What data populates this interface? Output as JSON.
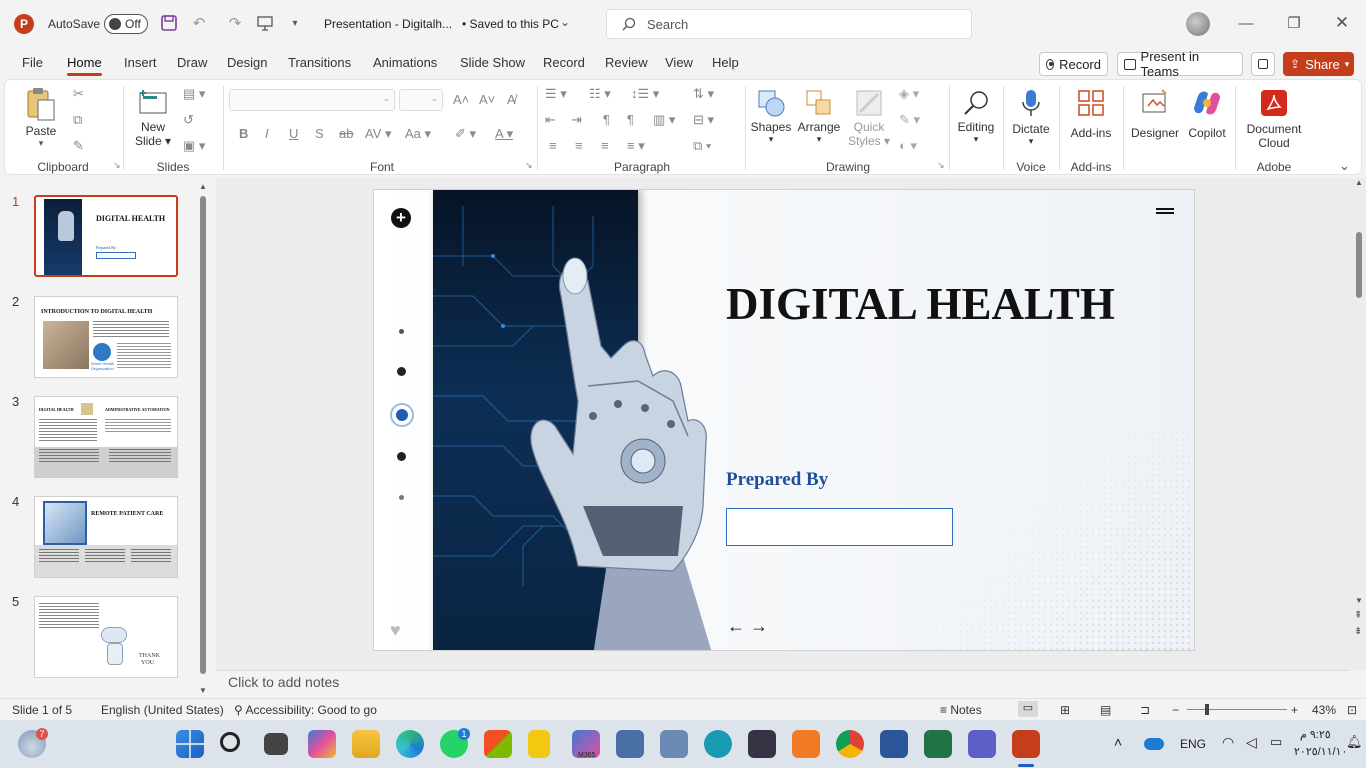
{
  "titlebar": {
    "autosave_label": "AutoSave",
    "autosave_state": "Off",
    "doc_title": "Presentation - Digitalh...",
    "save_status": "• Saved to this PC",
    "search_placeholder": "Search"
  },
  "menu": {
    "tabs": [
      "File",
      "Home",
      "Insert",
      "Draw",
      "Design",
      "Transitions",
      "Animations",
      "Slide Show",
      "Record",
      "Review",
      "View",
      "Help"
    ],
    "active_tab": "Home",
    "record_label": "Record",
    "present_teams_label": "Present in Teams",
    "share_label": "Share"
  },
  "ribbon": {
    "clipboard": {
      "paste": "Paste",
      "label": "Clipboard"
    },
    "slides": {
      "new_slide_line1": "New",
      "new_slide_line2": "Slide",
      "label": "Slides"
    },
    "font": {
      "label": "Font"
    },
    "paragraph": {
      "label": "Paragraph"
    },
    "drawing": {
      "shapes": "Shapes",
      "arrange": "Arrange",
      "quick_styles_line1": "Quick",
      "quick_styles_line2": "Styles",
      "label": "Drawing"
    },
    "editing": {
      "label": "Editing"
    },
    "voice": {
      "dictate": "Dictate",
      "label": "Voice"
    },
    "addins": {
      "addins": "Add-ins",
      "label": "Add-ins"
    },
    "designer": "Designer",
    "copilot": "Copilot",
    "adobe": {
      "document_cloud_line1": "Document",
      "document_cloud_line2": "Cloud",
      "label": "Adobe"
    }
  },
  "thumbnails": [
    {
      "num": "1",
      "title": "DIGITAL HEALTH",
      "subtitle": "Prepared By"
    },
    {
      "num": "2",
      "title": "INTRODUCTION TO DIGITAL HEALTH",
      "org_line1": "World Health",
      "org_line2": "Organization"
    },
    {
      "num": "3",
      "title": "DIGITAL HEALTH",
      "title2": "ADMINISTRATIVE AUTOMATION"
    },
    {
      "num": "4",
      "title": "REMOTE PATIENT CARE"
    },
    {
      "num": "5",
      "thank_line1": "THANK",
      "thank_line2": "YOU"
    }
  ],
  "slide": {
    "title": "DIGITAL HEALTH",
    "prepared_by": "Prepared By",
    "arrows": "← →"
  },
  "notes_placeholder": "Click to add notes",
  "status": {
    "slide_count": "Slide 1 of 5",
    "language": "English (United States)",
    "accessibility": "Accessibility: Good to go",
    "notes": "Notes",
    "zoom": "43%"
  },
  "taskbar": {
    "weather_badge": "7",
    "lang": "ENG",
    "time": "٩:٢٥ م",
    "date": "٢٠٢٥/١١/١٠",
    "whatsapp_badge": "1",
    "m365_label": "M365"
  },
  "colors": {
    "accent": "#c43e1c",
    "title_color": "#111111",
    "prepared_color": "#1f4e9c",
    "box_border": "#2e6fbf",
    "share_bg": "#c43e1c"
  }
}
